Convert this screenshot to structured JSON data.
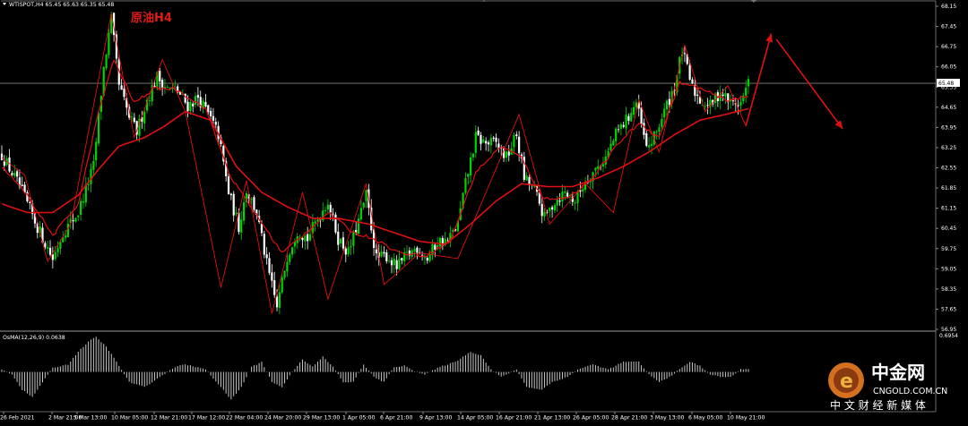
{
  "header": {
    "symbol_line": "WTISPOT,H4  65.45 65.63 65.35 65.48",
    "annotation": "原油H4",
    "osma_label": "OsMA(12,26,9) 0.0638",
    "osma_max": "0.6954",
    "current_price": "65.48"
  },
  "watermark": {
    "name": "中金网",
    "url": "CNGOLD.COM.CN",
    "tagline": "中 文 财 经 新 媒 体"
  },
  "colors": {
    "background": "#000000",
    "bull_candle": "#00d400",
    "bear_candle": "#ffffff",
    "ma_line": "#e01010",
    "arrow": "#e01010",
    "osma_bar": "#c8c8c8",
    "price_line": "#b0b0b0"
  },
  "chart_data": {
    "type": "candlestick",
    "symbol": "WTISPOT",
    "timeframe": "H4",
    "y_ticks": [
      "68.15",
      "67.45",
      "66.75",
      "66.05",
      "65.35",
      "64.65",
      "63.95",
      "63.25",
      "62.55",
      "61.85",
      "61.15",
      "60.45",
      "59.75",
      "59.05",
      "58.35",
      "57.65",
      "56.95"
    ],
    "ylim": [
      56.95,
      68.15
    ],
    "x_ticks": [
      "26 Feb 2021",
      "2 Mar 21:00",
      "5 Mar 13:00",
      "10 Mar 05:00",
      "12 Mar 21:00",
      "17 Mar 12:00",
      "22 Mar 04:00",
      "24 Mar 20:00",
      "29 Mar 13:00",
      "1 Apr 05:00",
      "6 Apr 21:00",
      "9 Apr 13:00",
      "14 Apr 05:00",
      "16 Apr 21:00",
      "21 Apr 13:00",
      "26 Apr 05:00",
      "28 Apr 21:00",
      "3 May 13:00",
      "6 May 05:00",
      "10 May 21:00"
    ],
    "price_anchors": [
      [
        0,
        63.0
      ],
      [
        7,
        61.9
      ],
      [
        14,
        60.5
      ],
      [
        20,
        59.4
      ],
      [
        24,
        60.3
      ],
      [
        30,
        61.0
      ],
      [
        36,
        62.6
      ],
      [
        40,
        66.0
      ],
      [
        43,
        67.7
      ],
      [
        46,
        65.4
      ],
      [
        50,
        64.3
      ],
      [
        53,
        63.8
      ],
      [
        57,
        64.9
      ],
      [
        61,
        65.7
      ],
      [
        65,
        65.3
      ],
      [
        69,
        65.2
      ],
      [
        73,
        64.7
      ],
      [
        77,
        65.0
      ],
      [
        81,
        64.4
      ],
      [
        85,
        63.7
      ],
      [
        89,
        61.7
      ],
      [
        93,
        60.5
      ],
      [
        96,
        61.8
      ],
      [
        100,
        61.0
      ],
      [
        104,
        59.2
      ],
      [
        108,
        57.7
      ],
      [
        112,
        59.5
      ],
      [
        116,
        60.4
      ],
      [
        120,
        60.1
      ],
      [
        124,
        60.8
      ],
      [
        128,
        61.4
      ],
      [
        132,
        60.1
      ],
      [
        136,
        59.6
      ],
      [
        140,
        60.7
      ],
      [
        143,
        61.6
      ],
      [
        147,
        59.4
      ],
      [
        151,
        59.5
      ],
      [
        155,
        59.1
      ],
      [
        159,
        59.5
      ],
      [
        163,
        59.8
      ],
      [
        167,
        59.4
      ],
      [
        171,
        60.0
      ],
      [
        175,
        60.0
      ],
      [
        179,
        60.6
      ],
      [
        182,
        62.0
      ],
      [
        186,
        63.6
      ],
      [
        190,
        63.4
      ],
      [
        194,
        63.4
      ],
      [
        198,
        62.9
      ],
      [
        202,
        63.7
      ],
      [
        205,
        62.2
      ],
      [
        209,
        61.8
      ],
      [
        213,
        60.8
      ],
      [
        217,
        61.4
      ],
      [
        221,
        61.7
      ],
      [
        225,
        61.4
      ],
      [
        229,
        62.1
      ],
      [
        233,
        62.5
      ],
      [
        237,
        62.9
      ],
      [
        241,
        63.7
      ],
      [
        245,
        64.2
      ],
      [
        249,
        64.8
      ],
      [
        253,
        63.2
      ],
      [
        256,
        63.6
      ],
      [
        260,
        64.5
      ],
      [
        264,
        65.4
      ],
      [
        267,
        66.6
      ],
      [
        271,
        65.3
      ],
      [
        274,
        64.9
      ],
      [
        278,
        64.7
      ],
      [
        282,
        65.2
      ],
      [
        286,
        64.8
      ],
      [
        290,
        64.8
      ],
      [
        293,
        65.48
      ]
    ],
    "ma_fast_anchors": [
      [
        0,
        62.6
      ],
      [
        10,
        61.6
      ],
      [
        20,
        60.2
      ],
      [
        30,
        61.3
      ],
      [
        38,
        64.5
      ],
      [
        44,
        66.3
      ],
      [
        52,
        64.8
      ],
      [
        60,
        65.3
      ],
      [
        68,
        65.3
      ],
      [
        80,
        64.6
      ],
      [
        90,
        62.2
      ],
      [
        100,
        60.9
      ],
      [
        110,
        59.6
      ],
      [
        118,
        60.2
      ],
      [
        128,
        61.0
      ],
      [
        138,
        60.3
      ],
      [
        146,
        60.1
      ],
      [
        156,
        59.6
      ],
      [
        166,
        59.5
      ],
      [
        176,
        60.0
      ],
      [
        186,
        62.4
      ],
      [
        196,
        63.3
      ],
      [
        204,
        62.9
      ],
      [
        212,
        61.5
      ],
      [
        222,
        61.5
      ],
      [
        232,
        62.2
      ],
      [
        242,
        63.4
      ],
      [
        250,
        64.1
      ],
      [
        258,
        63.6
      ],
      [
        266,
        65.5
      ],
      [
        274,
        65.3
      ],
      [
        284,
        64.9
      ],
      [
        293,
        65.0
      ]
    ],
    "ma_slow_anchors": [
      [
        0,
        61.3
      ],
      [
        10,
        61.0
      ],
      [
        20,
        61.0
      ],
      [
        30,
        61.6
      ],
      [
        38,
        62.5
      ],
      [
        46,
        63.3
      ],
      [
        56,
        63.6
      ],
      [
        64,
        64.0
      ],
      [
        72,
        64.5
      ],
      [
        82,
        64.2
      ],
      [
        92,
        62.6
      ],
      [
        102,
        61.7
      ],
      [
        112,
        61.2
      ],
      [
        122,
        60.8
      ],
      [
        132,
        60.8
      ],
      [
        144,
        60.6
      ],
      [
        154,
        60.3
      ],
      [
        164,
        60.0
      ],
      [
        174,
        59.9
      ],
      [
        184,
        60.6
      ],
      [
        194,
        61.4
      ],
      [
        204,
        62.0
      ],
      [
        214,
        61.9
      ],
      [
        224,
        61.9
      ],
      [
        234,
        62.2
      ],
      [
        244,
        62.6
      ],
      [
        254,
        63.1
      ],
      [
        264,
        63.7
      ],
      [
        274,
        64.2
      ],
      [
        284,
        64.4
      ],
      [
        293,
        64.6
      ]
    ],
    "zigzag_anchors": [
      [
        0,
        62.9
      ],
      [
        9,
        62.3
      ],
      [
        18,
        59.3
      ],
      [
        27,
        60.6
      ],
      [
        43,
        67.9
      ],
      [
        52,
        63.6
      ],
      [
        63,
        66.3
      ],
      [
        72,
        64.5
      ],
      [
        86,
        58.4
      ],
      [
        96,
        62.1
      ],
      [
        106,
        57.5
      ],
      [
        118,
        61.7
      ],
      [
        128,
        58.0
      ],
      [
        143,
        62.0
      ],
      [
        150,
        58.5
      ],
      [
        164,
        59.6
      ],
      [
        179,
        59.4
      ],
      [
        203,
        64.4
      ],
      [
        215,
        60.6
      ],
      [
        229,
        62.0
      ],
      [
        240,
        61.0
      ],
      [
        250,
        64.9
      ],
      [
        258,
        63.1
      ],
      [
        268,
        66.8
      ],
      [
        276,
        64.5
      ],
      [
        285,
        65.4
      ],
      [
        292,
        64.0
      ]
    ],
    "forecast_arrows": [
      {
        "from": [
          292,
          64.0
        ],
        "to": [
          302,
          67.2
        ]
      },
      {
        "from": [
          304,
          67.0
        ],
        "to": [
          330,
          63.9
        ]
      }
    ],
    "osma_anchors": [
      [
        0,
        0.05
      ],
      [
        4,
        -0.05
      ],
      [
        8,
        -0.35
      ],
      [
        12,
        -0.5
      ],
      [
        16,
        -0.2
      ],
      [
        20,
        0.08
      ],
      [
        26,
        0.15
      ],
      [
        30,
        0.4
      ],
      [
        34,
        0.6
      ],
      [
        37,
        0.69
      ],
      [
        41,
        0.5
      ],
      [
        45,
        0.2
      ],
      [
        50,
        -0.2
      ],
      [
        56,
        -0.3
      ],
      [
        62,
        -0.1
      ],
      [
        68,
        0.1
      ],
      [
        72,
        0.15
      ],
      [
        80,
        0.05
      ],
      [
        86,
        -0.3
      ],
      [
        90,
        -0.55
      ],
      [
        94,
        -0.3
      ],
      [
        98,
        0.1
      ],
      [
        102,
        0.2
      ],
      [
        106,
        -0.2
      ],
      [
        110,
        -0.3
      ],
      [
        114,
        0.0
      ],
      [
        118,
        0.25
      ],
      [
        122,
        0.1
      ],
      [
        126,
        0.3
      ],
      [
        130,
        0.1
      ],
      [
        134,
        -0.2
      ],
      [
        138,
        -0.2
      ],
      [
        142,
        0.15
      ],
      [
        146,
        -0.1
      ],
      [
        150,
        -0.2
      ],
      [
        154,
        0.1
      ],
      [
        158,
        0.12
      ],
      [
        162,
        0.02
      ],
      [
        166,
        -0.05
      ],
      [
        172,
        0.1
      ],
      [
        178,
        0.2
      ],
      [
        184,
        0.4
      ],
      [
        188,
        0.33
      ],
      [
        192,
        0.05
      ],
      [
        196,
        -0.1
      ],
      [
        202,
        0.05
      ],
      [
        206,
        -0.3
      ],
      [
        212,
        -0.35
      ],
      [
        216,
        -0.2
      ],
      [
        222,
        -0.1
      ],
      [
        226,
        0.05
      ],
      [
        232,
        0.15
      ],
      [
        238,
        0.05
      ],
      [
        244,
        0.2
      ],
      [
        250,
        0.2
      ],
      [
        254,
        -0.05
      ],
      [
        258,
        -0.2
      ],
      [
        262,
        -0.1
      ],
      [
        266,
        0.05
      ],
      [
        270,
        0.2
      ],
      [
        274,
        0.12
      ],
      [
        278,
        -0.05
      ],
      [
        282,
        -0.1
      ],
      [
        286,
        -0.1
      ],
      [
        290,
        0.05
      ],
      [
        293,
        0.06
      ]
    ],
    "osma_ylim": [
      -0.75,
      0.7
    ]
  }
}
